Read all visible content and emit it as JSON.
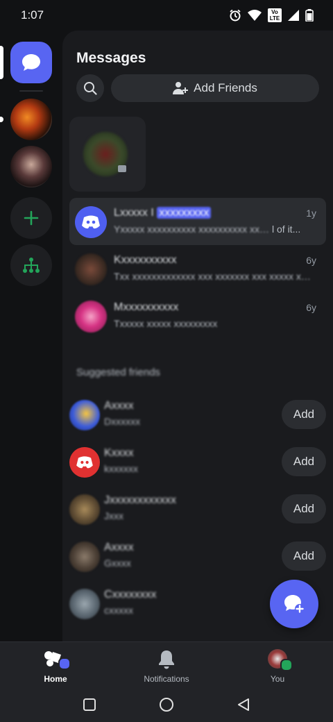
{
  "status_bar": {
    "time": "1:07",
    "network_badge": "Vo LTE"
  },
  "header": {
    "title": "Messages",
    "add_friends_label": "Add Friends"
  },
  "dms": [
    {
      "name_prefix": "Lxxxxx I",
      "name_highlight": "xxxxxxxxx",
      "preview": "Yxxxxx xxxxxxxxxx xxxxxxxxxx xxxxxxxxx",
      "preview_end": "l of it...",
      "time": "1y",
      "avatar_color": "#4f5ff0"
    },
    {
      "name_prefix": "Kxxxxxxxxxx",
      "name_highlight": "",
      "preview": "Txx xxxxxxxxxxxxx xxx xxxxxxx xxx xxxxx xx e mo...",
      "preview_end": "",
      "time": "6y",
      "avatar_color": "#5c3a2e"
    },
    {
      "name_prefix": "Mxxxxxxxxxx",
      "name_highlight": "",
      "preview": "Txxxxx xxxxx xxxxxxxxx",
      "preview_end": "",
      "time": "6y",
      "avatar_color": "#d63384"
    }
  ],
  "suggestions": {
    "label": "Suggested friends",
    "add_label": "Add",
    "items": [
      {
        "name": "Axxxx",
        "username": "Dxxxxxx",
        "avatar_color": "#3b5bdb"
      },
      {
        "name": "Kxxxx",
        "username": "kxxxxxx",
        "avatar_color": "#e03131"
      },
      {
        "name": "Jxxxxxxxxxxxx",
        "username": "Jxxx",
        "avatar_color": "#8a6d3b"
      },
      {
        "name": "Axxxx",
        "username": "Gxxxx",
        "avatar_color": "#6b5b4b"
      },
      {
        "name": "Cxxxxxxxx",
        "username": "cxxxxx",
        "avatar_color": "#5a6670"
      }
    ]
  },
  "bottom_nav": {
    "home": "Home",
    "notifications": "Notifications",
    "you": "You"
  },
  "colors": {
    "accent": "#5865f2",
    "green": "#23a55a",
    "background": "#111214",
    "panel": "#1a1b1e"
  }
}
